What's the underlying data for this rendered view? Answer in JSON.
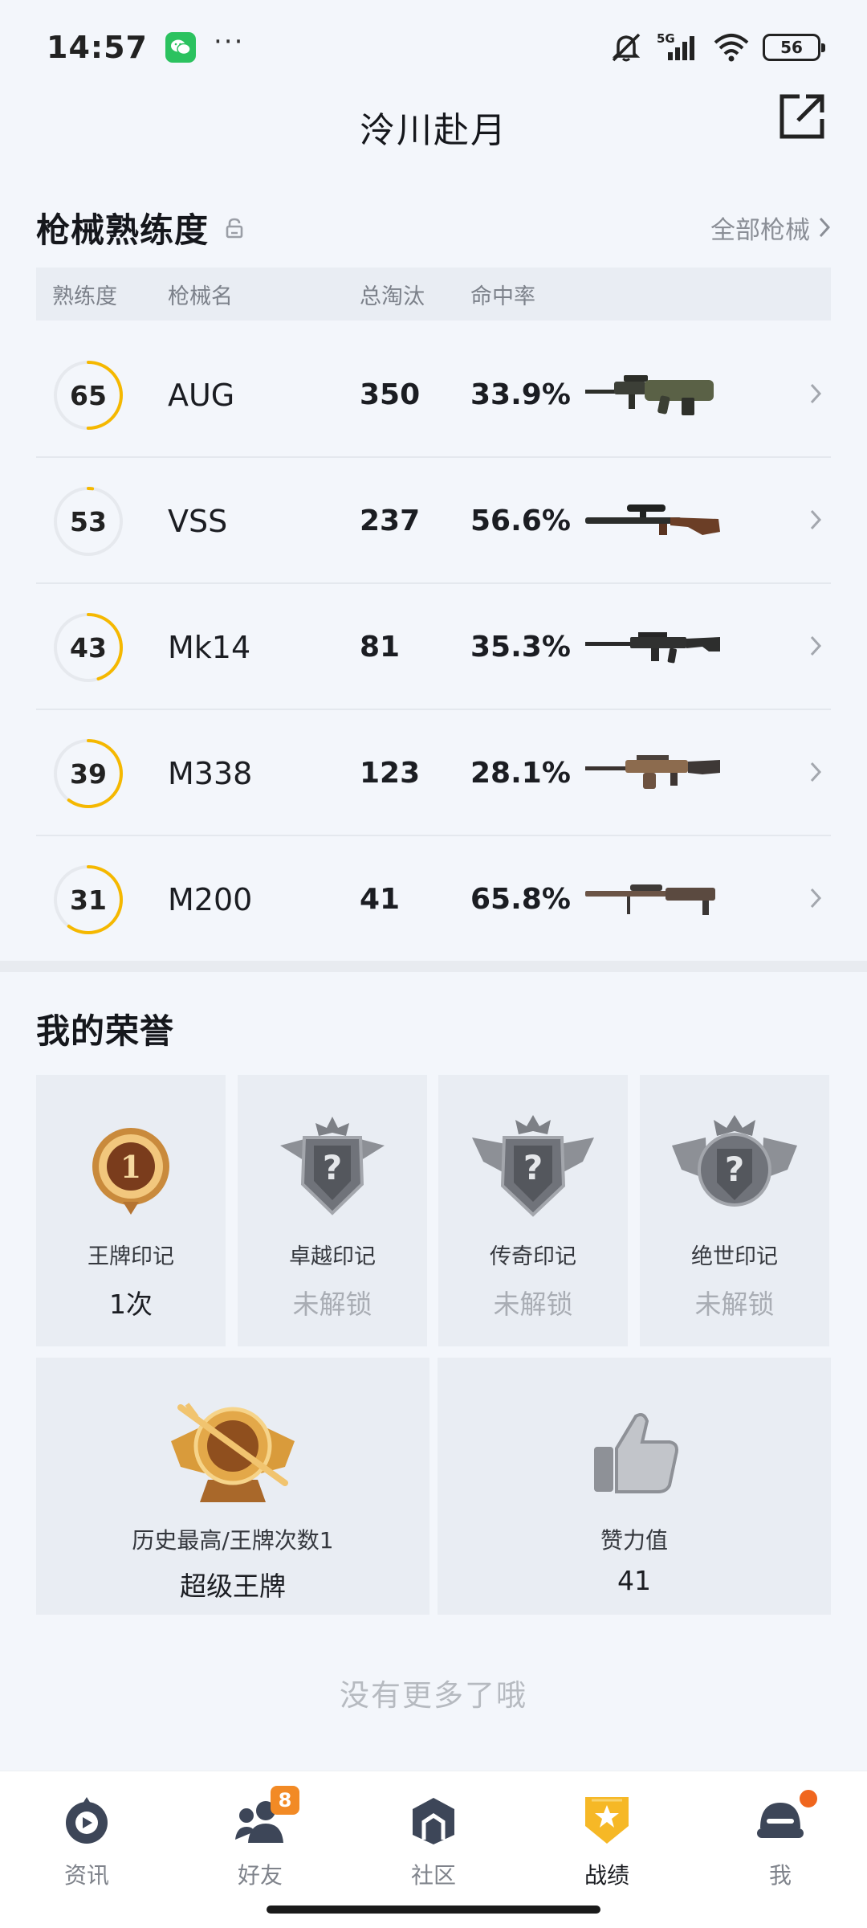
{
  "status_bar": {
    "time": "14:57",
    "network": "5G",
    "battery": "56",
    "icons": [
      "wechat-icon",
      "more-dots-icon",
      "mute-icon",
      "signal-icon",
      "wifi-icon",
      "battery-icon"
    ]
  },
  "header": {
    "title": "泠川赴月",
    "share_icon": "share-external-icon"
  },
  "weapons": {
    "section_title": "枪械熟练度",
    "all_link": "全部枪械",
    "columns": {
      "proficiency": "熟练度",
      "name": "枪械名",
      "kills": "总淘汰",
      "accuracy": "命中率"
    },
    "rows": [
      {
        "proficiency": "65",
        "progress": 0.5,
        "name": "AUG",
        "kills": "350",
        "accuracy": "33.9%"
      },
      {
        "proficiency": "53",
        "progress": 0.02,
        "name": "VSS",
        "kills": "237",
        "accuracy": "56.6%"
      },
      {
        "proficiency": "43",
        "progress": 0.45,
        "name": "Mk14",
        "kills": "81",
        "accuracy": "35.3%"
      },
      {
        "proficiency": "39",
        "progress": 0.6,
        "name": "M338",
        "kills": "123",
        "accuracy": "28.1%"
      },
      {
        "proficiency": "31",
        "progress": 0.6,
        "name": "M200",
        "kills": "41",
        "accuracy": "65.8%"
      }
    ],
    "accent_color": "#f5b800"
  },
  "honor": {
    "section_title": "我的荣誉",
    "cards": [
      {
        "label": "王牌印记",
        "value": "1次",
        "locked": false
      },
      {
        "label": "卓越印记",
        "value": "未解锁",
        "locked": true
      },
      {
        "label": "传奇印记",
        "value": "未解锁",
        "locked": true
      },
      {
        "label": "绝世印记",
        "value": "未解锁",
        "locked": true
      }
    ],
    "best": {
      "label": "历史最高/王牌次数1",
      "value": "超级王牌"
    },
    "likes": {
      "label": "赞力值",
      "value": "41"
    }
  },
  "footer_text": "没有更多了哦",
  "nav": {
    "items": [
      {
        "label": "资讯",
        "icon": "news-icon",
        "active": false
      },
      {
        "label": "好友",
        "icon": "friends-icon",
        "active": false,
        "badge": "8"
      },
      {
        "label": "社区",
        "icon": "community-icon",
        "active": false
      },
      {
        "label": "战绩",
        "icon": "record-icon",
        "active": true
      },
      {
        "label": "我",
        "icon": "profile-icon",
        "active": false,
        "dot": true
      }
    ]
  }
}
